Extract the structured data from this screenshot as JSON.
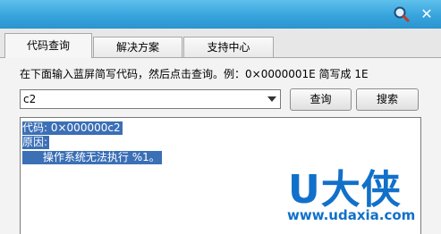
{
  "titlebar": {
    "icons": [
      "magnifier-icon",
      "close-icon"
    ],
    "close_glyph": "✕"
  },
  "tabs": [
    {
      "label": "代码查询",
      "active": true
    },
    {
      "label": "解决方案",
      "active": false
    },
    {
      "label": "支持中心",
      "active": false
    }
  ],
  "instruction": "在下面输入蓝屏简写代码，然后点击查询。例：0×0000001E 简写成 1E",
  "code_input": {
    "value": "c2"
  },
  "buttons": {
    "query": "查询",
    "search": "搜索"
  },
  "result": {
    "line1": "代码: 0×000000c2",
    "line2": "原因:",
    "line3": "      操作系统无法执行 %1。"
  },
  "watermark": {
    "brand": "U大侠",
    "url": "www.udaxia.com"
  },
  "colors": {
    "titlebar": "#37a4dd",
    "selection": "#3b6fb6",
    "watermark": "#1170c9"
  }
}
